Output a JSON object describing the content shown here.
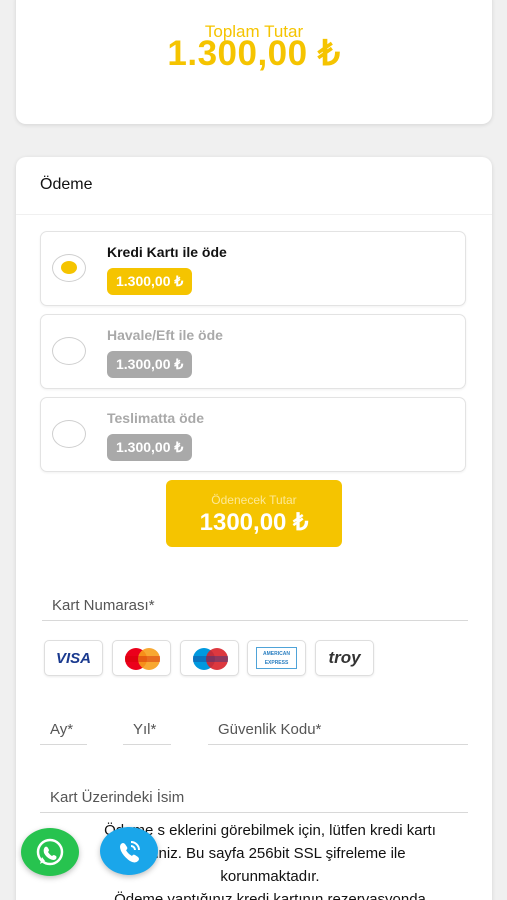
{
  "summary": {
    "label": "Toplam Tutar",
    "value": "1.300,00 ₺"
  },
  "payment": {
    "title": "Ödeme",
    "options": [
      {
        "label": "Kredi Kartı ile öde",
        "price": "1.300,00 ₺",
        "selected": true
      },
      {
        "label": "Havale/Eft ile öde",
        "price": "1.300,00 ₺",
        "selected": false
      },
      {
        "label": "Teslimatta öde",
        "price": "1.300,00 ₺",
        "selected": false
      }
    ],
    "due": {
      "label": "Ödenecek Tutar",
      "value": "1300,00 ₺"
    }
  },
  "card_form": {
    "card_number_placeholder": "Kart Numarası*",
    "month_placeholder": "Ay*",
    "year_placeholder": "Yıl*",
    "cvv_placeholder": "Güvenlik Kodu*",
    "name_placeholder": "Kart Üzerindeki İsim",
    "brands": [
      {
        "name": "VISA",
        "icon": "visa-logo"
      },
      {
        "name": "MasterCard",
        "icon": "mastercard-logo"
      },
      {
        "name": "Maestro",
        "icon": "maestro-logo"
      },
      {
        "name": "AMERICAN EXPRESS",
        "icon": "amex-logo"
      },
      {
        "name": "troy",
        "icon": "troy-logo"
      }
    ]
  },
  "info_text": {
    "line1": "Ödeme s   eklerini görebilmek için, lütfen kredi kartı",
    "line2": "na         iniz. Bu sayfa 256bit SSL şifreleme ile",
    "line3": "korunmaktadır.",
    "line4": "Ödeme yaptığınız kredi kartının rezervasyonda"
  },
  "fabs": {
    "whatsapp_icon": "whatsapp-icon",
    "call_icon": "phone-call-icon"
  },
  "colors": {
    "accent": "#f5c400",
    "disabled": "#a9a9a9",
    "whatsapp": "#27c34f",
    "call": "#1aa6ea"
  }
}
